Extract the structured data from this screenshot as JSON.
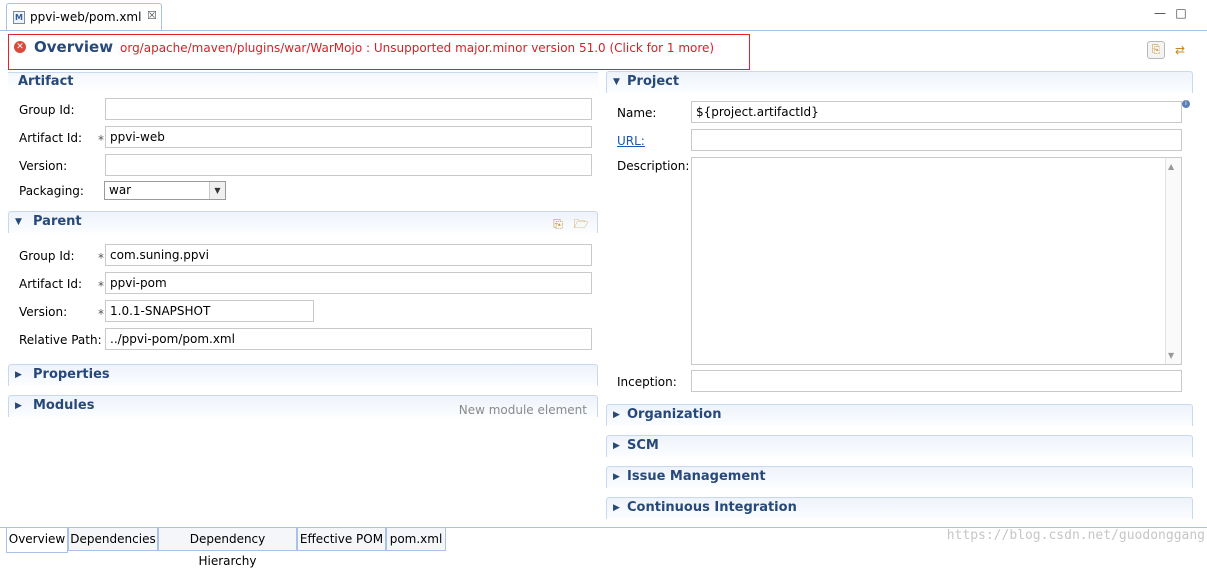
{
  "tab": {
    "title": "ppvi-web/pom.xml",
    "close": "☒",
    "file_icon_letter": "M"
  },
  "window": {
    "minimize": "—",
    "maximize": "□"
  },
  "header": {
    "title": "Overview",
    "error": "org/apache/maven/plugins/war/WarMojo : Unsupported major.minor version 51.0 (Click for 1 more)",
    "error_icon_glyph": "✕"
  },
  "artifact": {
    "title": "Artifact",
    "group_id_label": "Group Id:",
    "group_id": "",
    "artifact_id_label": "Artifact Id:",
    "artifact_id": "ppvi-web",
    "version_label": "Version:",
    "version": "",
    "packaging_label": "Packaging:",
    "packaging": "war"
  },
  "parent": {
    "title": "Parent",
    "group_id_label": "Group Id:",
    "group_id": "com.suning.ppvi",
    "artifact_id_label": "Artifact Id:",
    "artifact_id": "ppvi-pom",
    "version_label": "Version:",
    "version": "1.0.1-SNAPSHOT",
    "relative_path_label": "Relative Path:",
    "relative_path": "../ppvi-pom/pom.xml"
  },
  "properties": {
    "title": "Properties"
  },
  "modules": {
    "title": "Modules",
    "hint": "New module element"
  },
  "project": {
    "title": "Project",
    "name_label": "Name:",
    "name": "${project.artifactId}",
    "url_label": "URL:",
    "url": "",
    "description_label": "Description:",
    "description": "",
    "inception_label": "Inception:",
    "inception": ""
  },
  "collapsed_sections": [
    "Organization",
    "SCM",
    "Issue Management",
    "Continuous Integration"
  ],
  "bottom_tabs": [
    "Overview",
    "Dependencies",
    "Dependency Hierarchy",
    "Effective POM",
    "pom.xml"
  ],
  "selected_bottom_tab": "Overview",
  "required_marker": "*",
  "info_marker": "i",
  "watermark": "https://blog.csdn.net/guodonggang",
  "colors": {
    "section_title": "#27497a",
    "error_text": "#d8202a",
    "link": "#1b56b3",
    "error_border": "#e8202a"
  },
  "icons": [
    "maven-file-icon",
    "close-icon",
    "minimize-icon",
    "maximize-icon",
    "error-icon",
    "open-pom-icon",
    "refresh-icon",
    "open-parent-icon",
    "folder-icon",
    "info-icon"
  ]
}
